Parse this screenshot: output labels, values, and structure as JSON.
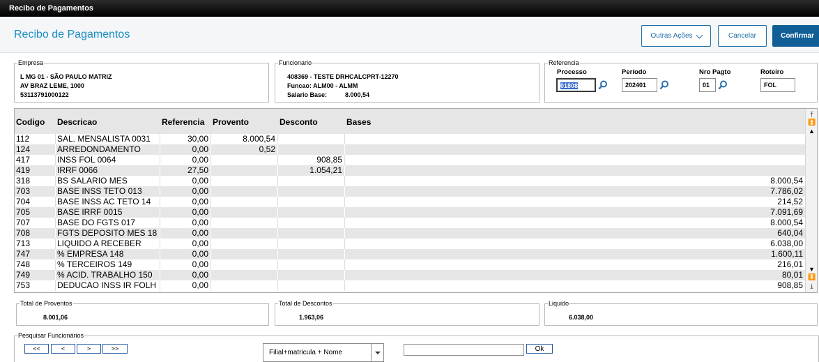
{
  "window": {
    "title": "Recibo de Pagamentos"
  },
  "header": {
    "page_title": "Recibo de Pagamentos",
    "outras_acoes": "Outras Ações",
    "cancelar": "Cancelar",
    "confirmar": "Confirmar"
  },
  "empresa": {
    "legend": "Empresa",
    "line1": "L MG 01  - SÃO PAULO MATRIZ",
    "line2": "AV BRAZ LEME, 1000",
    "line3": "53113791000122"
  },
  "funcionario": {
    "legend": "Funcionario",
    "line1": "408369 - TESTE DRHCALCPRT-12270",
    "line2": "Funcao: ALM00 - ALMM",
    "salario_label": "Salario Base:",
    "salario_value": "8.000,54"
  },
  "referencia": {
    "legend": "Referencia",
    "processo_label": "Processo",
    "processo_value": "01808",
    "periodo_label": "Período",
    "periodo_value": "202401",
    "nro_pagto_label": "Nro Pagto",
    "nro_pagto_value": "01",
    "roteiro_label": "Roteiro",
    "roteiro_value": "FOL"
  },
  "grid": {
    "columns": [
      "Codigo",
      "Descricao",
      "Referencia",
      "Provento",
      "Desconto",
      "Bases"
    ],
    "rows": [
      [
        "112",
        "SAL. MENSALISTA 0031",
        "30,00",
        "8.000,54",
        "",
        ""
      ],
      [
        "124",
        "ARREDONDAMENTO",
        "0,00",
        "0,52",
        "",
        ""
      ],
      [
        "417",
        "INSS FOL 0064",
        "0,00",
        "",
        "908,85",
        ""
      ],
      [
        "419",
        "IRRF 0066",
        "27,50",
        "",
        "1.054,21",
        ""
      ],
      [
        "318",
        "BS SALARIO MES",
        "0,00",
        "",
        "",
        "8.000,54"
      ],
      [
        "703",
        "BASE INSS TETO 013",
        "0,00",
        "",
        "",
        "7.786,02"
      ],
      [
        "704",
        "BASE INSS AC TETO 14",
        "0,00",
        "",
        "",
        "214,52"
      ],
      [
        "705",
        "BASE IRRF 0015",
        "0,00",
        "",
        "",
        "7.091,69"
      ],
      [
        "707",
        "BASE DO FGTS 017",
        "0,00",
        "",
        "",
        "8.000,54"
      ],
      [
        "708",
        "FGTS DEPOSITO MES 18",
        "0,00",
        "",
        "",
        "640,04"
      ],
      [
        "713",
        "LIQUIDO A RECEBER",
        "0,00",
        "",
        "",
        "6.038,00"
      ],
      [
        "747",
        "% EMPRESA 148",
        "0,00",
        "",
        "",
        "1.600,11"
      ],
      [
        "748",
        "% TERCEIROS 149",
        "0,00",
        "",
        "",
        "216,01"
      ],
      [
        "749",
        "% ACID. TRABALHO 150",
        "0,00",
        "",
        "",
        "80,01"
      ],
      [
        "753",
        "DEDUCAO INSS IR FOLH",
        "0,00",
        "",
        "",
        "908,85"
      ]
    ]
  },
  "totals": {
    "proventos_label": "Total de Proventos",
    "proventos_value": "8.001,06",
    "descontos_label": "Total de Descontos",
    "descontos_value": "1.963,06",
    "liquido_label": "Liquido",
    "liquido_value": "6.038,00"
  },
  "pesquisa": {
    "legend": "Pesquisar Funcionários",
    "first": "<<",
    "prev": "<",
    "next": ">",
    "last": ">>",
    "combo_value": "Filial+matricula + Nome",
    "search_value": "",
    "ok": "Ok"
  }
}
